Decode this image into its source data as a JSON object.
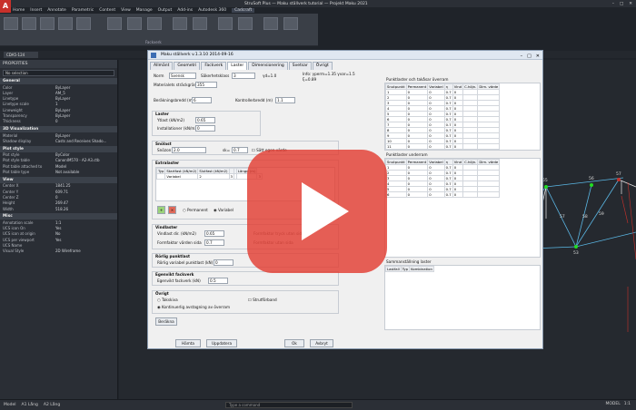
{
  "app": {
    "title": "StruSoft Plus — Maku ställverk tutorial — Projekt Maku 2021",
    "logo": "A",
    "menus": [
      "Home",
      "Insert",
      "Annotate",
      "Parametric",
      "Content",
      "View",
      "Manage",
      "Output",
      "Add-ins",
      "Autodesk 360",
      "Cadcraft"
    ],
    "active_menu": "Cadcraft",
    "ribbon_group": "Fackverk",
    "doc_tab": "CDA5-124"
  },
  "properties": {
    "header": "PROPERTIES",
    "selection": "No selection",
    "sections": [
      {
        "name": "General",
        "rows": [
          [
            "Color",
            "ByLayer"
          ],
          [
            "Layer",
            "AM_5"
          ],
          [
            "Linetype",
            "ByLayer"
          ],
          [
            "Linetype scale",
            "1"
          ],
          [
            "Lineweight",
            "ByLayer"
          ],
          [
            "Transparency",
            "ByLayer"
          ],
          [
            "Thickness",
            "0"
          ]
        ]
      },
      {
        "name": "3D Visualization",
        "rows": [
          [
            "Material",
            "ByLayer"
          ],
          [
            "Shadow display",
            "Casts and Receives Shado..."
          ]
        ]
      },
      {
        "name": "Plot style",
        "rows": [
          [
            "Plot style",
            "ByColor"
          ],
          [
            "Plot style table",
            "CanonIM570 - A2-A3.ctb"
          ],
          [
            "Plot table attached to",
            "Model"
          ],
          [
            "Plot table type",
            "Not available"
          ]
        ]
      },
      {
        "name": "View",
        "rows": [
          [
            "Center X",
            "1841.25"
          ],
          [
            "Center Y",
            "609.71"
          ],
          [
            "Center Z",
            "0"
          ],
          [
            "Height",
            "269.47"
          ],
          [
            "Width",
            "518.26"
          ]
        ]
      },
      {
        "name": "Misc",
        "rows": [
          [
            "Annotation scale",
            "1:1"
          ],
          [
            "UCS icon On",
            "Yes"
          ],
          [
            "UCS icon at origin",
            "No"
          ],
          [
            "UCS per viewport",
            "Yes"
          ],
          [
            "UCS Name",
            ""
          ],
          [
            "Visual Style",
            "2D Wireframe"
          ]
        ]
      }
    ]
  },
  "dialog": {
    "title": "Maku ställverk v.1.3.10 2014-09-16",
    "tabs": [
      "Allmänt",
      "Geometri",
      "Fackverk",
      "Laster",
      "Dimensionering",
      "Svetsar",
      "Övrigt"
    ],
    "active_tab": "Laster",
    "norm_label": "Norm",
    "norm_value": "Svensk",
    "sakerhet_label": "Säkerhetsklass",
    "sakerhet_value": "3",
    "gamma": "γd=1.0",
    "info_line1": "Info: γperm=1.35  γvar=1.5",
    "info_line2": "ξ=0.89",
    "material_label": "Materialets sträckgräns",
    "material_value": "355",
    "berakning_label": "Beräkningsbredd (m)",
    "berakning_value": "6",
    "kontroll_label": "Kontrollerbredd (m)",
    "kontroll_value": "1.1",
    "laster_title": "Laster",
    "ytlast_label": "Ytlast (kN/m2)",
    "ytlast_value": "0.65",
    "installation_label": "Installationer (kN/m2)",
    "installation_value": "0",
    "snolast_title": "Snölast",
    "snozon_label": "Snözon",
    "snozon_value": "2.0",
    "sk_label": "sk=",
    "sk_value": "0.7",
    "egen_check": "Sätt egen värde",
    "extra_title": "Extralaster",
    "extra_cols": [
      "Typ",
      "Startfast (kN/m2)",
      "Slutfast (kN/m2)",
      "",
      "",
      "Längd (m)"
    ],
    "extra_rows": [
      [
        "",
        "Variabel",
        "2",
        "3",
        "",
        "",
        "3"
      ]
    ],
    "perm_radio": "Permanent",
    "var_radio": "Variabel",
    "vind_title": "Vindlaster",
    "vind_label": "Vindlast dir. (kN/m2)",
    "vind_value": "0.65",
    "formfaktor_label": "Formfaktor värden sida",
    "formfaktor_value": "0.7",
    "vind_right1": "Formfaktor tryck utan sida",
    "vind_right2": "Formfaktor utan sida",
    "rorlig_title": "Rörlig punktlast",
    "rorlig_label": "Rörlig variabel punktlast (kN)",
    "rorlig_value": "0",
    "egenvikt_title": "Egenvikt fackverk",
    "egenvikt_label": "Egenvikt fackverk (kN)",
    "egenvikt_value": "0.5",
    "ovrigt_title": "Övrigt",
    "takskiva": "Takskiva",
    "stomforband": "Strutförband",
    "kontinuerlig": "Kontinuerlig avstagning av överram",
    "berakna_btn": "Beräkna",
    "right_title": "Punktlaster och takåsar överram",
    "right_cols": [
      "Snutpunkt",
      "Permanent",
      "Variabel",
      "η",
      "Vind",
      "C.höjn.",
      "Dim. värde"
    ],
    "right_rows": [
      [
        "1",
        "0",
        "0",
        "0.7",
        "0",
        "",
        ""
      ],
      [
        "2",
        "0",
        "0",
        "0.7",
        "0",
        "",
        ""
      ],
      [
        "3",
        "0",
        "0",
        "0.7",
        "0",
        "",
        ""
      ],
      [
        "4",
        "0",
        "0",
        "0.7",
        "0",
        "",
        ""
      ],
      [
        "5",
        "0",
        "0",
        "0.7",
        "0",
        "",
        ""
      ],
      [
        "6",
        "0",
        "0",
        "0.7",
        "0",
        "",
        ""
      ],
      [
        "7",
        "0",
        "0",
        "0.7",
        "0",
        "",
        ""
      ],
      [
        "8",
        "0",
        "0",
        "0.7",
        "0",
        "",
        ""
      ],
      [
        "9",
        "0",
        "0",
        "0.7",
        "0",
        "",
        ""
      ],
      [
        "10",
        "0",
        "0",
        "0.7",
        "0",
        "",
        ""
      ],
      [
        "11",
        "0",
        "0",
        "0.7",
        "0",
        "",
        ""
      ]
    ],
    "right2_title": "Punktlaster underram",
    "right2_cols": [
      "Snutpunkt",
      "Permanent",
      "Variabel",
      "η",
      "Vind",
      "C.höjn.",
      "Dim. värde"
    ],
    "right2_rows": [
      [
        "1",
        "0",
        "0",
        "0.7",
        "0",
        "",
        ""
      ],
      [
        "2",
        "0",
        "0",
        "0.7",
        "0",
        "",
        ""
      ],
      [
        "3",
        "0",
        "0",
        "0.7",
        "0",
        "",
        ""
      ],
      [
        "4",
        "0",
        "0",
        "0.7",
        "0",
        "",
        ""
      ],
      [
        "5",
        "0",
        "0",
        "0.7",
        "0",
        "",
        ""
      ],
      [
        "6",
        "0",
        "0",
        "0.7",
        "0",
        "",
        ""
      ]
    ],
    "right3_title": "Sammanställning laster",
    "right3_cols": [
      "Lastfall",
      "Typ",
      "Kombination"
    ],
    "btn_hamta": "Hämta",
    "btn_uppdatera": "Uppdatera",
    "btn_ok": "Ok",
    "btn_avbryt": "Avbryt"
  },
  "drawing": {
    "nodes": [
      "55",
      "56",
      "57",
      "57",
      "58",
      "59",
      "53"
    ]
  },
  "status": {
    "tabs": [
      "Model",
      "A1 Lång",
      "A2 Lång"
    ],
    "command_placeholder": "Type a command",
    "right": [
      "MODEL",
      "1:1"
    ]
  },
  "colors": {
    "truss_blue": "#5bb8e6",
    "truss_green": "#22dd22",
    "play_red": "#e23d32"
  }
}
